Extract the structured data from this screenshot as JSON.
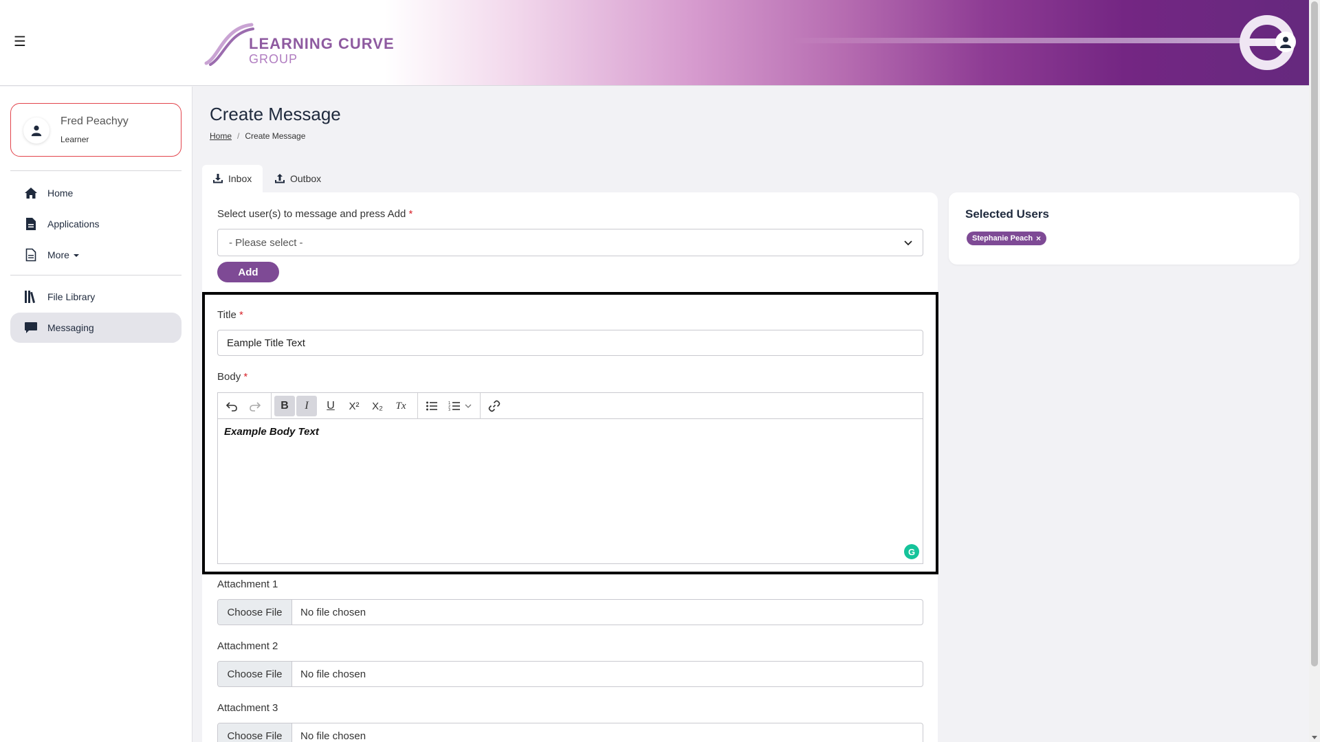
{
  "header": {
    "logo_line1": "LEARNING CURVE",
    "logo_line2": "GROUP",
    "colors": {
      "brand_purple": "#7e4a95",
      "header_dark": "#65297e"
    }
  },
  "sidebar": {
    "profile": {
      "name": "Fred Peachyy",
      "role": "Learner"
    },
    "items": [
      {
        "label": "Home",
        "icon": "home-icon"
      },
      {
        "label": "Applications",
        "icon": "document-icon"
      },
      {
        "label": "More",
        "icon": "file-icon"
      },
      {
        "label": "File Library",
        "icon": "library-icon"
      },
      {
        "label": "Messaging",
        "icon": "chat-icon",
        "active": true
      }
    ]
  },
  "page": {
    "title": "Create Message",
    "breadcrumb": {
      "home": "Home",
      "separator": "/",
      "current": "Create Message"
    }
  },
  "tabs": [
    {
      "label": "Inbox",
      "icon": "download-icon",
      "active": true
    },
    {
      "label": "Outbox",
      "icon": "upload-icon"
    }
  ],
  "form": {
    "select_label": "Select user(s) to message and press Add",
    "select_value": "- Please select -",
    "add_label": "Add",
    "required_mark": "*",
    "title_label": "Title",
    "title_value": "Eample Title Text",
    "body_label": "Body",
    "body_value": "Example Body Text",
    "toolbar": {
      "undo": "undo-icon",
      "redo": "redo-icon",
      "bold": "B",
      "italic": "I",
      "underline": "U",
      "superscript": "X²",
      "subscript": "X₂",
      "clear_format": "Tx",
      "bullet_list": "bullet-list-icon",
      "numbered_list": "numbered-list-icon",
      "link": "link-icon"
    },
    "attachments": [
      {
        "label": "Attachment 1",
        "button": "Choose File",
        "status": "No file chosen"
      },
      {
        "label": "Attachment 2",
        "button": "Choose File",
        "status": "No file chosen"
      },
      {
        "label": "Attachment 3",
        "button": "Choose File",
        "status": "No file chosen"
      }
    ]
  },
  "selected_users": {
    "title": "Selected Users",
    "users": [
      {
        "name": "Stephanie Peach",
        "remove": "×"
      }
    ]
  }
}
